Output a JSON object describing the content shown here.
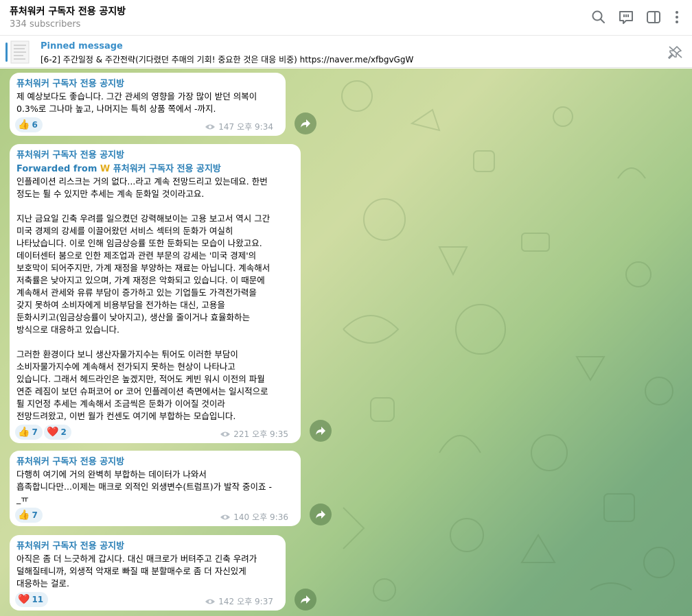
{
  "header": {
    "title": "퓨처워커 구독자 전용 공지방",
    "subscribers": "334 subscribers"
  },
  "pinned": {
    "label": "Pinned message",
    "text": "[6-2] 주간일정 & 주간전략(기다렸던 추매의 기회! 중요한 것은 대응 비중)  https://naver.me/xfbgvGgW"
  },
  "messages": [
    {
      "author": "퓨처워커 구독자 전용 공지방",
      "text": "제 예상보다도 좋습니다. 그간 관세의 영향을 가장 많이 받던 의복이\n0.3%로 그나마 높고, 나머지는 특히 상품 쪽에서 -까지.",
      "reactions": [
        {
          "emoji": "👍",
          "count": "6"
        }
      ],
      "views": "147",
      "time": "오후 9:34"
    },
    {
      "author": "퓨처워커 구독자 전용 공지방",
      "forwarded_prefix": "Forwarded from",
      "forwarded_icon": "W",
      "forwarded_name": "퓨처워커 구독자 전용 공지방",
      "text": "인플레이션 리스크는 거의 없다...라고 계속 전망드리고 있는데요. 한번\n정도는 튈 수 있지만 추세는 계속 둔화일 것이라고요.\n\n지난 금요일 긴축 우려를 일으켰던 강력해보이는 고용 보고서 역시 그간\n미국 경제의 강세를 이끌어왔던 서비스 섹터의 둔화가 여실히\n나타났습니다. 이로 인해 임금상승률 또한 둔화되는 모습이 나왔고요.\n데이터센터 붐으로 인한 제조업과 관련 부문의 강세는 '미국 경제'의\n보호막이 되어주지만, 가계 재정을 부양하는 재료는 아닙니다. 계속해서\n저축률은 낮아지고 있으며, 가계 재정은 악화되고 있습니다. 이 때문에\n계속해서 관세와 유류 부담이 증가하고 있는 기업들도 가격전가력을\n갖지 못하여 소비자에게 비용부담을 전가하는 대신, 고용을\n둔화시키고(임금상승률이 낮아지고), 생산을 줄이거나 효율화하는\n방식으로 대응하고 있습니다.\n\n그러한 환경이다 보니 생산자물가지수는 튀어도 이러한 부담이\n소비자물가지수에 계속해서 전가되지 못하는 현상이 나타나고\n있습니다. 그래서 헤드라인은 높겠지만, 적어도 케빈 워시 이전의 파월\n연준 레짐이 보던 슈퍼코어 or 코어 인플레이션 측면에서는 일시적으로\n튈 지언정 추세는 계속해서 조금씩은 둔화가 이어질 것이라\n전망드려왔고, 이번 월가 컨센도 여기에 부합하는 모습입니다.",
      "reactions": [
        {
          "emoji": "👍",
          "count": "7"
        },
        {
          "emoji": "❤️",
          "count": "2"
        }
      ],
      "views": "221",
      "time": "오후 9:35"
    },
    {
      "author": "퓨처워커 구독자 전용 공지방",
      "text": "다행히 여기에 거의 완벽히 부합하는 데이터가 나와서\n흡족합니다만...이제는 매크로 외적인 외생변수(트럼프)가 발작 중이죠 -\n_ㅠ",
      "reactions": [
        {
          "emoji": "👍",
          "count": "7"
        }
      ],
      "views": "140",
      "time": "오후 9:36"
    },
    {
      "author": "퓨처워커 구독자 전용 공지방",
      "text": "아직은 좀 더 느긋하게 갑시다. 대신 매크로가 버텨주고 긴축 우려가\n덜해질테니까, 외생적 악재로 빠질 때 분할매수로 좀 더 자신있게\n대응하는 걸로.",
      "reactions": [
        {
          "emoji": "❤️",
          "count": "11"
        }
      ],
      "views": "142",
      "time": "오후 9:37"
    }
  ],
  "icons": {
    "search": "search-icon",
    "comments": "comments-icon",
    "sidebar": "sidebar-toggle-icon",
    "more": "more-vertical-icon",
    "unpin": "unpin-icon",
    "views": "eye-icon",
    "share": "share-arrow-icon"
  },
  "colors": {
    "accent": "#2a7fb6",
    "pinned_label": "#3a8fc9",
    "reaction_bg": "#e7f1f8",
    "meta": "#9aa3ab"
  }
}
